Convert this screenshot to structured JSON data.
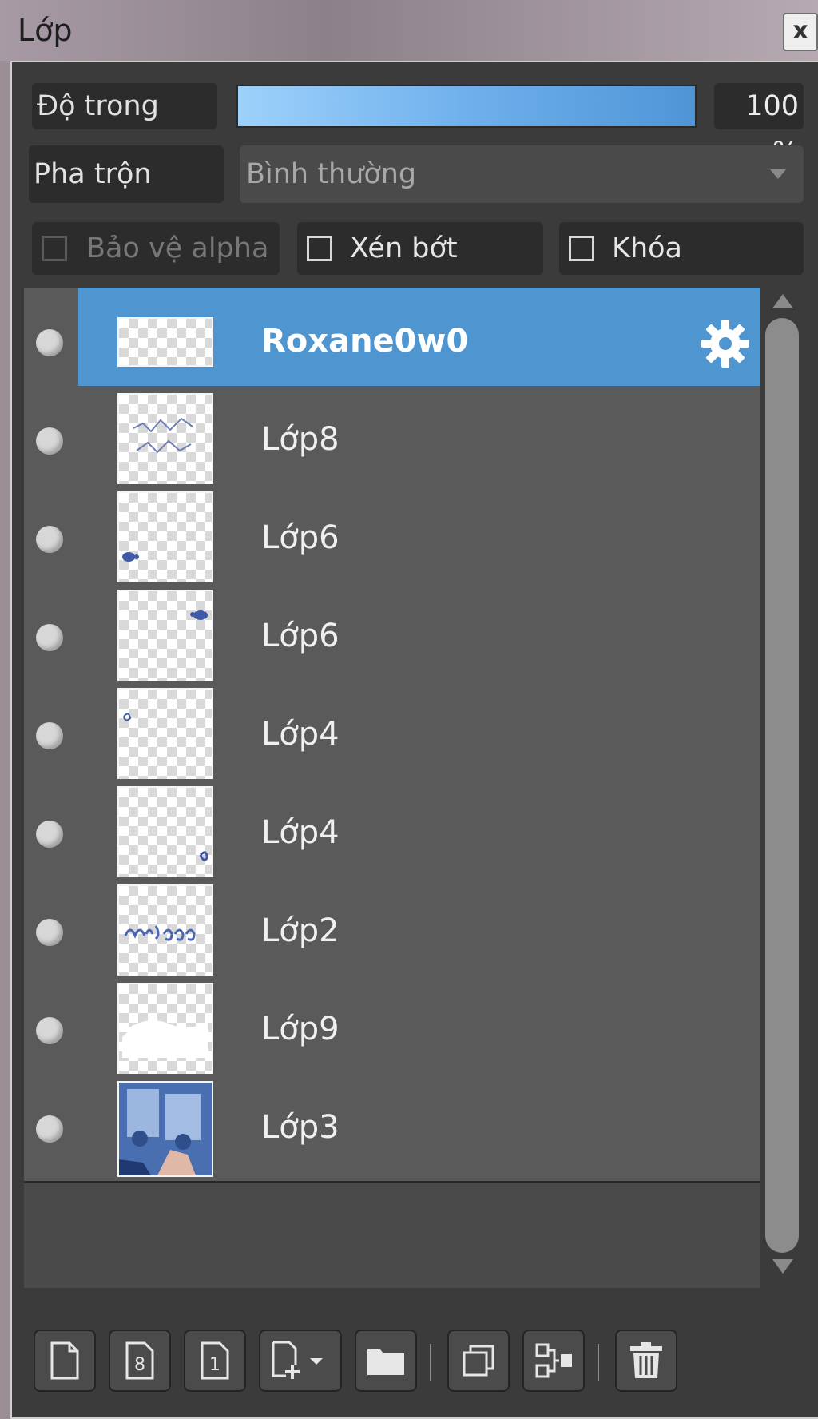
{
  "window": {
    "title": "Lớp",
    "close_label": "x"
  },
  "opacity": {
    "label": "Độ trong",
    "value": "100 %",
    "fill_percent": 100
  },
  "blend": {
    "label": "Pha trộn",
    "value": "Bình thường"
  },
  "checks": {
    "alpha": {
      "label": "Bảo vệ alpha",
      "checked": false,
      "enabled": false
    },
    "clip": {
      "label": "Xén bớt",
      "checked": false,
      "enabled": true
    },
    "lock": {
      "label": "Khóa",
      "checked": false,
      "enabled": true
    }
  },
  "layers": [
    {
      "name": "Roxane0w0",
      "selected": true,
      "icon": "gear-icon"
    },
    {
      "name": "Lớp8"
    },
    {
      "name": "Lớp6"
    },
    {
      "name": "Lớp6"
    },
    {
      "name": "Lớp4"
    },
    {
      "name": "Lớp4"
    },
    {
      "name": "Lớp2"
    },
    {
      "name": "Lớp9"
    },
    {
      "name": "Lớp3"
    }
  ],
  "toolbar": {
    "buttons": [
      "new-layer-icon",
      "new-layer-8bit-icon",
      "new-layer-1bit-icon",
      "add-layer-menu-icon",
      "new-folder-icon",
      "duplicate-layer-icon",
      "merge-down-icon",
      "delete-layer-icon"
    ]
  },
  "colors": {
    "selected_row": "#4f96d1",
    "row": "#5a5a5a",
    "opacity_bar": "#6fb0ec"
  }
}
